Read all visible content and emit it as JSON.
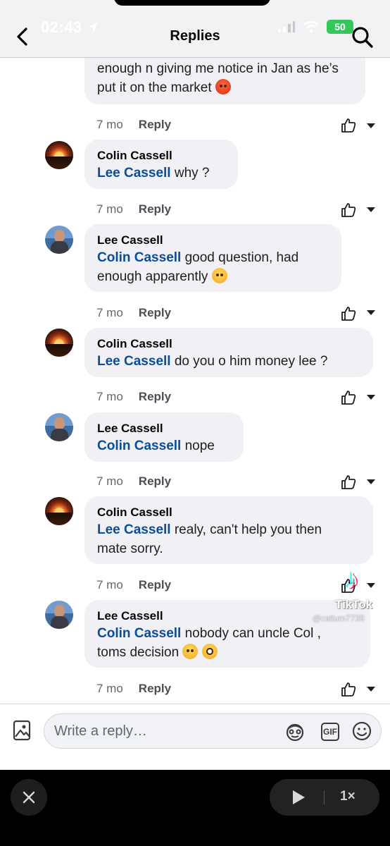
{
  "status_bar": {
    "time": "02:43",
    "battery": "50"
  },
  "header": {
    "title": "Replies"
  },
  "thread": {
    "partial_text": "enough n giving me notice in Jan as he’s put it on the market",
    "comments": [
      {
        "name": "Colin Cassell",
        "mention": "Lee Cassell",
        "text": " why ?"
      },
      {
        "name": "Lee Cassell",
        "mention": "Colin Cassell",
        "text_line1": " good question, had",
        "text_line2": "enough apparently"
      },
      {
        "name": "Colin Cassell",
        "mention": "Lee Cassell",
        "text": " do you o him money lee ?"
      },
      {
        "name": "Lee Cassell",
        "mention": "Colin Cassell",
        "text": " nope"
      },
      {
        "name": "Colin Cassell",
        "mention": "Lee Cassell",
        "text_line1": " realy, can't help you then",
        "text_line2": "mate sorry."
      },
      {
        "name": "Lee Cassell",
        "mention": "Colin Cassell",
        "text_line1": " nobody can uncle Col  ,",
        "text_line2": "toms decision"
      }
    ],
    "meta": {
      "age": "7 mo",
      "reply_label": "Reply"
    }
  },
  "watermark": {
    "brand": "TikTok",
    "handle": "@callum7738"
  },
  "composer": {
    "placeholder": "Write a reply…",
    "gif_label": "GIF"
  },
  "player": {
    "speed_label": "1×"
  }
}
